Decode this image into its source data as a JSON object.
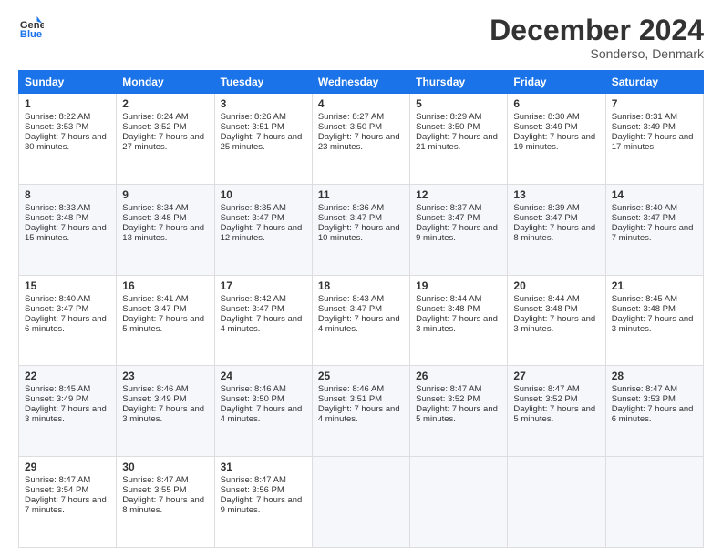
{
  "header": {
    "logo_line1": "General",
    "logo_line2": "Blue",
    "month": "December 2024",
    "location": "Sonderso, Denmark"
  },
  "days_of_week": [
    "Sunday",
    "Monday",
    "Tuesday",
    "Wednesday",
    "Thursday",
    "Friday",
    "Saturday"
  ],
  "weeks": [
    [
      {
        "day": 1,
        "sunrise": "8:22 AM",
        "sunset": "3:53 PM",
        "daylight": "7 hours and 30 minutes."
      },
      {
        "day": 2,
        "sunrise": "8:24 AM",
        "sunset": "3:52 PM",
        "daylight": "7 hours and 27 minutes."
      },
      {
        "day": 3,
        "sunrise": "8:26 AM",
        "sunset": "3:51 PM",
        "daylight": "7 hours and 25 minutes."
      },
      {
        "day": 4,
        "sunrise": "8:27 AM",
        "sunset": "3:50 PM",
        "daylight": "7 hours and 23 minutes."
      },
      {
        "day": 5,
        "sunrise": "8:29 AM",
        "sunset": "3:50 PM",
        "daylight": "7 hours and 21 minutes."
      },
      {
        "day": 6,
        "sunrise": "8:30 AM",
        "sunset": "3:49 PM",
        "daylight": "7 hours and 19 minutes."
      },
      {
        "day": 7,
        "sunrise": "8:31 AM",
        "sunset": "3:49 PM",
        "daylight": "7 hours and 17 minutes."
      }
    ],
    [
      {
        "day": 8,
        "sunrise": "8:33 AM",
        "sunset": "3:48 PM",
        "daylight": "7 hours and 15 minutes."
      },
      {
        "day": 9,
        "sunrise": "8:34 AM",
        "sunset": "3:48 PM",
        "daylight": "7 hours and 13 minutes."
      },
      {
        "day": 10,
        "sunrise": "8:35 AM",
        "sunset": "3:47 PM",
        "daylight": "7 hours and 12 minutes."
      },
      {
        "day": 11,
        "sunrise": "8:36 AM",
        "sunset": "3:47 PM",
        "daylight": "7 hours and 10 minutes."
      },
      {
        "day": 12,
        "sunrise": "8:37 AM",
        "sunset": "3:47 PM",
        "daylight": "7 hours and 9 minutes."
      },
      {
        "day": 13,
        "sunrise": "8:39 AM",
        "sunset": "3:47 PM",
        "daylight": "7 hours and 8 minutes."
      },
      {
        "day": 14,
        "sunrise": "8:40 AM",
        "sunset": "3:47 PM",
        "daylight": "7 hours and 7 minutes."
      }
    ],
    [
      {
        "day": 15,
        "sunrise": "8:40 AM",
        "sunset": "3:47 PM",
        "daylight": "7 hours and 6 minutes."
      },
      {
        "day": 16,
        "sunrise": "8:41 AM",
        "sunset": "3:47 PM",
        "daylight": "7 hours and 5 minutes."
      },
      {
        "day": 17,
        "sunrise": "8:42 AM",
        "sunset": "3:47 PM",
        "daylight": "7 hours and 4 minutes."
      },
      {
        "day": 18,
        "sunrise": "8:43 AM",
        "sunset": "3:47 PM",
        "daylight": "7 hours and 4 minutes."
      },
      {
        "day": 19,
        "sunrise": "8:44 AM",
        "sunset": "3:48 PM",
        "daylight": "7 hours and 3 minutes."
      },
      {
        "day": 20,
        "sunrise": "8:44 AM",
        "sunset": "3:48 PM",
        "daylight": "7 hours and 3 minutes."
      },
      {
        "day": 21,
        "sunrise": "8:45 AM",
        "sunset": "3:48 PM",
        "daylight": "7 hours and 3 minutes."
      }
    ],
    [
      {
        "day": 22,
        "sunrise": "8:45 AM",
        "sunset": "3:49 PM",
        "daylight": "7 hours and 3 minutes."
      },
      {
        "day": 23,
        "sunrise": "8:46 AM",
        "sunset": "3:49 PM",
        "daylight": "7 hours and 3 minutes."
      },
      {
        "day": 24,
        "sunrise": "8:46 AM",
        "sunset": "3:50 PM",
        "daylight": "7 hours and 4 minutes."
      },
      {
        "day": 25,
        "sunrise": "8:46 AM",
        "sunset": "3:51 PM",
        "daylight": "7 hours and 4 minutes."
      },
      {
        "day": 26,
        "sunrise": "8:47 AM",
        "sunset": "3:52 PM",
        "daylight": "7 hours and 5 minutes."
      },
      {
        "day": 27,
        "sunrise": "8:47 AM",
        "sunset": "3:52 PM",
        "daylight": "7 hours and 5 minutes."
      },
      {
        "day": 28,
        "sunrise": "8:47 AM",
        "sunset": "3:53 PM",
        "daylight": "7 hours and 6 minutes."
      }
    ],
    [
      {
        "day": 29,
        "sunrise": "8:47 AM",
        "sunset": "3:54 PM",
        "daylight": "7 hours and 7 minutes."
      },
      {
        "day": 30,
        "sunrise": "8:47 AM",
        "sunset": "3:55 PM",
        "daylight": "7 hours and 8 minutes."
      },
      {
        "day": 31,
        "sunrise": "8:47 AM",
        "sunset": "3:56 PM",
        "daylight": "7 hours and 9 minutes."
      },
      null,
      null,
      null,
      null
    ]
  ]
}
